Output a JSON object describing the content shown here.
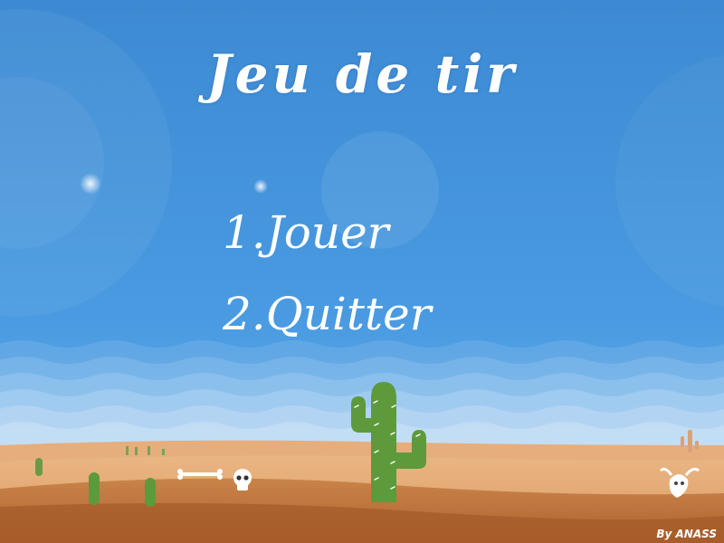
{
  "game": {
    "title": "Jeu de tir",
    "credit": "By ANASS"
  },
  "menu": {
    "items": [
      {
        "number": "1.",
        "label": "Jouer"
      },
      {
        "number": "2.",
        "label": "Quitter"
      }
    ]
  },
  "colors": {
    "sky_top": "#3f8fd6",
    "sky_bottom": "#9fd0f2",
    "sand_light": "#e5a570",
    "sand_dark": "#b56a34",
    "cactus": "#5d9a3c",
    "text": "#ffffff"
  },
  "icons": [
    "cactus-icon",
    "bone-icon",
    "skull-icon",
    "cow-skull-icon",
    "small-cactus-icon"
  ]
}
